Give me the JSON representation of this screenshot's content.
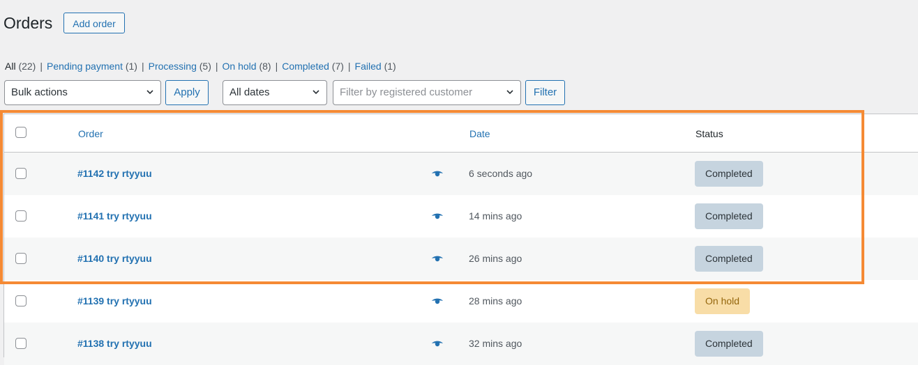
{
  "header": {
    "title": "Orders",
    "add_label": "Add order"
  },
  "filters_nav": [
    {
      "label": "All",
      "count": "(22)",
      "current": true
    },
    {
      "label": "Pending payment",
      "count": "(1)",
      "current": false
    },
    {
      "label": "Processing",
      "count": "(5)",
      "current": false
    },
    {
      "label": "On hold",
      "count": "(8)",
      "current": false
    },
    {
      "label": "Completed",
      "count": "(7)",
      "current": false
    },
    {
      "label": "Failed",
      "count": "(1)",
      "current": false
    }
  ],
  "toolbar": {
    "bulk_actions": "Bulk actions",
    "apply_label": "Apply",
    "dates": "All dates",
    "customer_placeholder": "Filter by registered customer",
    "filter_label": "Filter"
  },
  "table": {
    "columns": {
      "order": "Order",
      "date": "Date",
      "status": "Status"
    },
    "rows": [
      {
        "order": "#1142 try rtyyuu",
        "date": "6 seconds ago",
        "status": "Completed",
        "status_color": "#c6d4df",
        "status_text_color": "#2c3338"
      },
      {
        "order": "#1141 try rtyyuu",
        "date": "14 mins ago",
        "status": "Completed",
        "status_color": "#c6d4df",
        "status_text_color": "#2c3338"
      },
      {
        "order": "#1140 try rtyyuu",
        "date": "26 mins ago",
        "status": "Completed",
        "status_color": "#c6d4df",
        "status_text_color": "#2c3338"
      },
      {
        "order": "#1139 try rtyyuu",
        "date": "28 mins ago",
        "status": "On hold",
        "status_color": "#f8dda7",
        "status_text_color": "#94660c"
      },
      {
        "order": "#1138 try rtyyuu",
        "date": "32 mins ago",
        "status": "Completed",
        "status_color": "#c6d4df",
        "status_text_color": "#2c3338"
      }
    ]
  },
  "colors": {
    "accent": "#2271b1",
    "highlight": "#f58a34"
  }
}
